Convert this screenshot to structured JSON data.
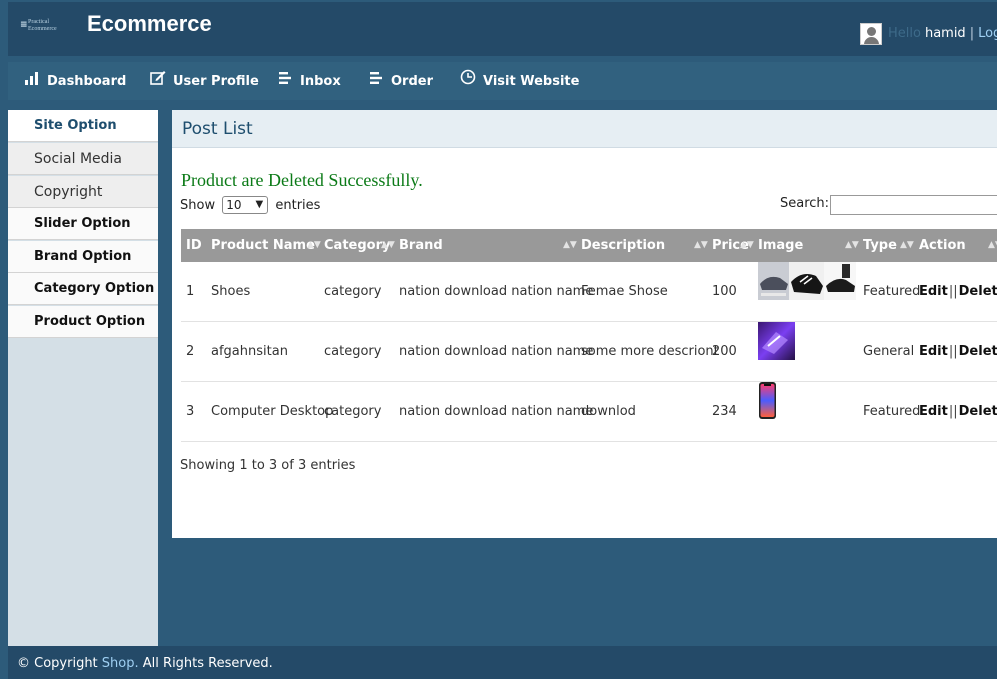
{
  "header": {
    "logo_line1": "Practical",
    "logo_line2": "Ecommerce",
    "title": "Ecommerce",
    "greeting": "Hello",
    "username": "hamid",
    "separator": "|",
    "logout": "Logout"
  },
  "nav": [
    {
      "label": "Dashboard",
      "icon": "bar-chart-icon"
    },
    {
      "label": "User Profile",
      "icon": "edit-icon"
    },
    {
      "label": "Inbox",
      "icon": "list-icon"
    },
    {
      "label": "Order",
      "icon": "list-icon"
    },
    {
      "label": "Visit Website",
      "icon": "globe-icon"
    }
  ],
  "sidebar": [
    {
      "label": "Site Option"
    },
    {
      "label": "Social Media"
    },
    {
      "label": "Copyright"
    },
    {
      "label": "Slider Option"
    },
    {
      "label": "Brand Option"
    },
    {
      "label": "Category Option"
    },
    {
      "label": "Product Option"
    }
  ],
  "panel": {
    "title": "Post List",
    "message": "Product are Deleted Successfully.",
    "show_label": "Show",
    "entries_value": "10",
    "entries_label": "entries",
    "search_label": "Search:",
    "info": "Showing 1 to 3 of 3 entries"
  },
  "table": {
    "columns": [
      "ID",
      "Product Name",
      "Category",
      "Brand",
      "Description",
      "Price",
      "Image",
      "Type",
      "Action"
    ],
    "rows": [
      {
        "id": "1",
        "name": "Shoes",
        "category": "category",
        "brand": "nation download nation name",
        "description": "Femae Shose",
        "price": "100",
        "type": "Featured",
        "edit": "Edit",
        "delete": "Delete"
      },
      {
        "id": "2",
        "name": "afgahnsitan",
        "category": "category",
        "brand": "nation download nation name",
        "description": "some more descriont",
        "price": "200",
        "type": "General",
        "edit": "Edit",
        "delete": "Delete"
      },
      {
        "id": "3",
        "name": "Computer Desktop",
        "category": "category",
        "brand": "nation download nation name",
        "description": "downlod",
        "price": "234",
        "type": "Featured",
        "edit": "Edit",
        "delete": "Delete"
      }
    ]
  },
  "footer": {
    "prefix": "© Copyright",
    "brand": "Shop.",
    "suffix": "All Rights Reserved."
  },
  "colors": {
    "background": "#2d5b7a",
    "header": "#244a68",
    "navbar": "#31617f",
    "success": "#0b7a17",
    "table_header": "#999999"
  }
}
